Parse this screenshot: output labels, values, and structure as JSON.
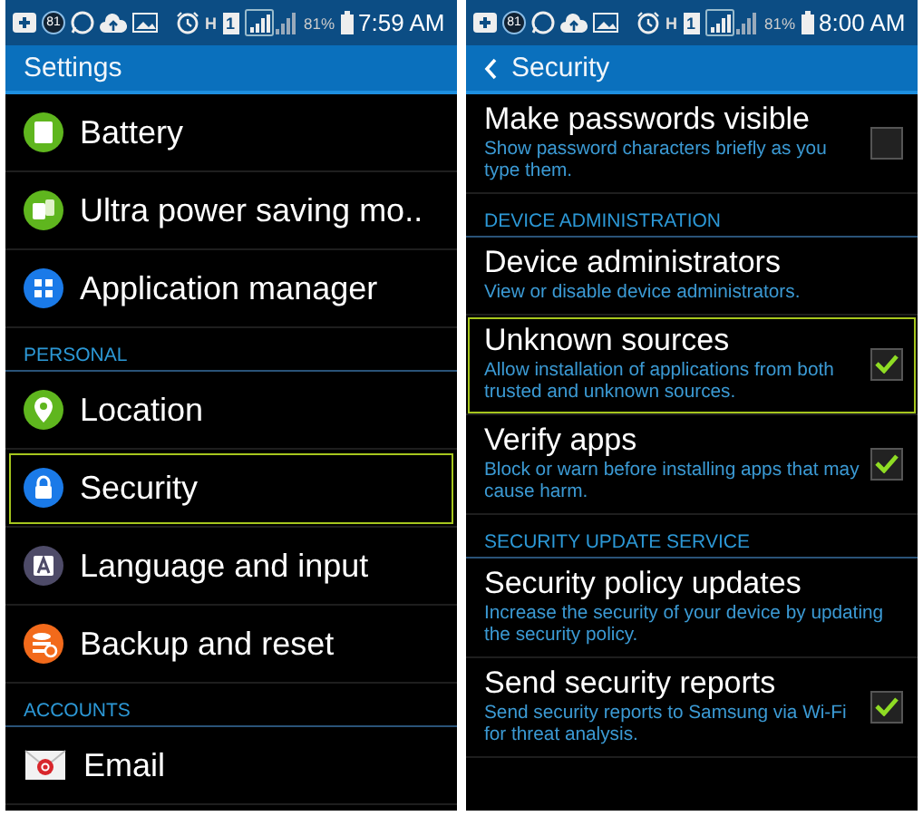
{
  "panels": [
    {
      "status_bar": {
        "badge": "81",
        "network": "H",
        "sim": "1",
        "battery": "81%",
        "time": "7:59 AM"
      },
      "title_bar": {
        "title": "Settings",
        "back": false
      },
      "items": [
        {
          "kind": "item",
          "label": "Battery",
          "selected": false
        },
        {
          "kind": "item",
          "label": "Ultra power saving mo..",
          "selected": false
        },
        {
          "kind": "item",
          "label": "Application manager",
          "selected": false
        },
        {
          "kind": "header",
          "label": "PERSONAL"
        },
        {
          "kind": "item",
          "label": "Location",
          "selected": false
        },
        {
          "kind": "item",
          "label": "Security",
          "selected": true
        },
        {
          "kind": "item",
          "label": "Language and input",
          "selected": false
        },
        {
          "kind": "item",
          "label": "Backup and reset",
          "selected": false
        },
        {
          "kind": "header",
          "label": "ACCOUNTS"
        },
        {
          "kind": "item",
          "label": "Email",
          "selected": false
        }
      ]
    },
    {
      "status_bar": {
        "badge": "81",
        "network": "H",
        "sim": "1",
        "battery": "81%",
        "time": "8:00 AM"
      },
      "title_bar": {
        "title": "Security",
        "back": true
      },
      "items": [
        {
          "kind": "setting",
          "title": "Make passwords visible",
          "summary": "Show password characters briefly as you type them.",
          "checked": false,
          "selected": false
        },
        {
          "kind": "header",
          "label": "DEVICE ADMINISTRATION"
        },
        {
          "kind": "setting",
          "title": "Device administrators",
          "summary": "View or disable device administrators.",
          "selected": false
        },
        {
          "kind": "setting",
          "title": "Unknown sources",
          "summary": "Allow installation of applications from both trusted and unknown sources.",
          "checked": true,
          "selected": true
        },
        {
          "kind": "setting",
          "title": "Verify apps",
          "summary": "Block or warn before installing apps that may cause harm.",
          "checked": true,
          "selected": false
        },
        {
          "kind": "header",
          "label": "SECURITY UPDATE SERVICE"
        },
        {
          "kind": "setting",
          "title": "Security policy updates",
          "summary": "Increase the security of your device by updating the security policy.",
          "selected": false
        },
        {
          "kind": "setting",
          "title": "Send security reports",
          "summary": "Send security reports to Samsung via Wi-Fi for threat analysis.",
          "checked": true,
          "selected": false
        }
      ]
    }
  ]
}
